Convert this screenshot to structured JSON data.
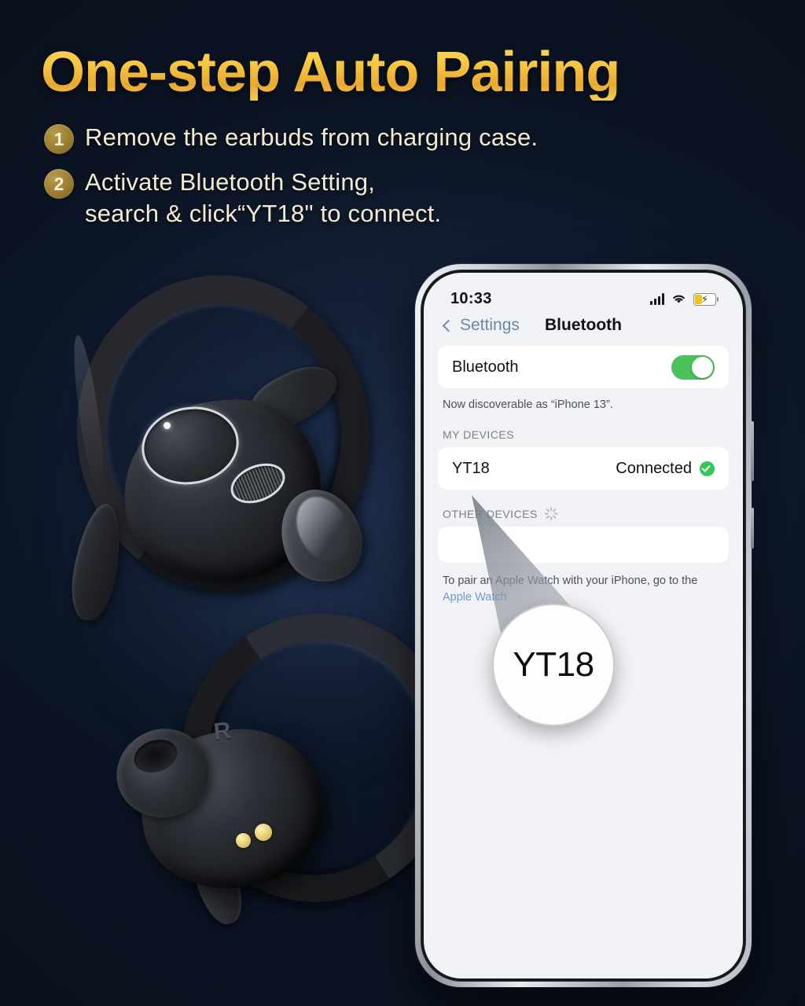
{
  "headline": "One-step Auto Pairing",
  "steps": [
    {
      "num": "1",
      "line1": "Remove the earbuds from charging case.",
      "line2": ""
    },
    {
      "num": "2",
      "line1": "Activate Bluetooth Setting,",
      "line2": "search & click“YT18\" to connect."
    }
  ],
  "earbuds": {
    "left_label": "",
    "right_label": "R"
  },
  "phone": {
    "status": {
      "time": "10:33",
      "signal_icon": "cellular-signal-icon",
      "wifi_icon": "wifi-icon",
      "battery_icon": "battery-charging-icon",
      "battery_bolt": "⚡"
    },
    "nav": {
      "back_label": "Settings",
      "title": "Bluetooth"
    },
    "bluetooth_row": {
      "label": "Bluetooth",
      "toggle_state": "on"
    },
    "discoverable_note": "Now discoverable as “iPhone 13”.",
    "my_devices": {
      "header": "MY DEVICES",
      "rows": [
        {
          "name": "YT18",
          "status": "Connected",
          "status_icon": "check-circle-icon"
        }
      ]
    },
    "other_devices": {
      "header": "OTHER DEVICES",
      "spinner_icon": "activity-spinner-icon",
      "rows": []
    },
    "footnote": {
      "text": "To pair an Apple Watch with your iPhone, go to the ",
      "link": "Apple Watch"
    }
  },
  "magnifier": {
    "label": "YT18"
  },
  "colors": {
    "background": "#0d1728",
    "headline_gold": "#f6c53f",
    "badge_gold": "#9a7d33",
    "body_text": "#f3ead2",
    "toggle_green": "#4cc25c",
    "check_green": "#35c759",
    "link_blue": "#6d9ad0",
    "battery_yellow": "#f0c419"
  }
}
